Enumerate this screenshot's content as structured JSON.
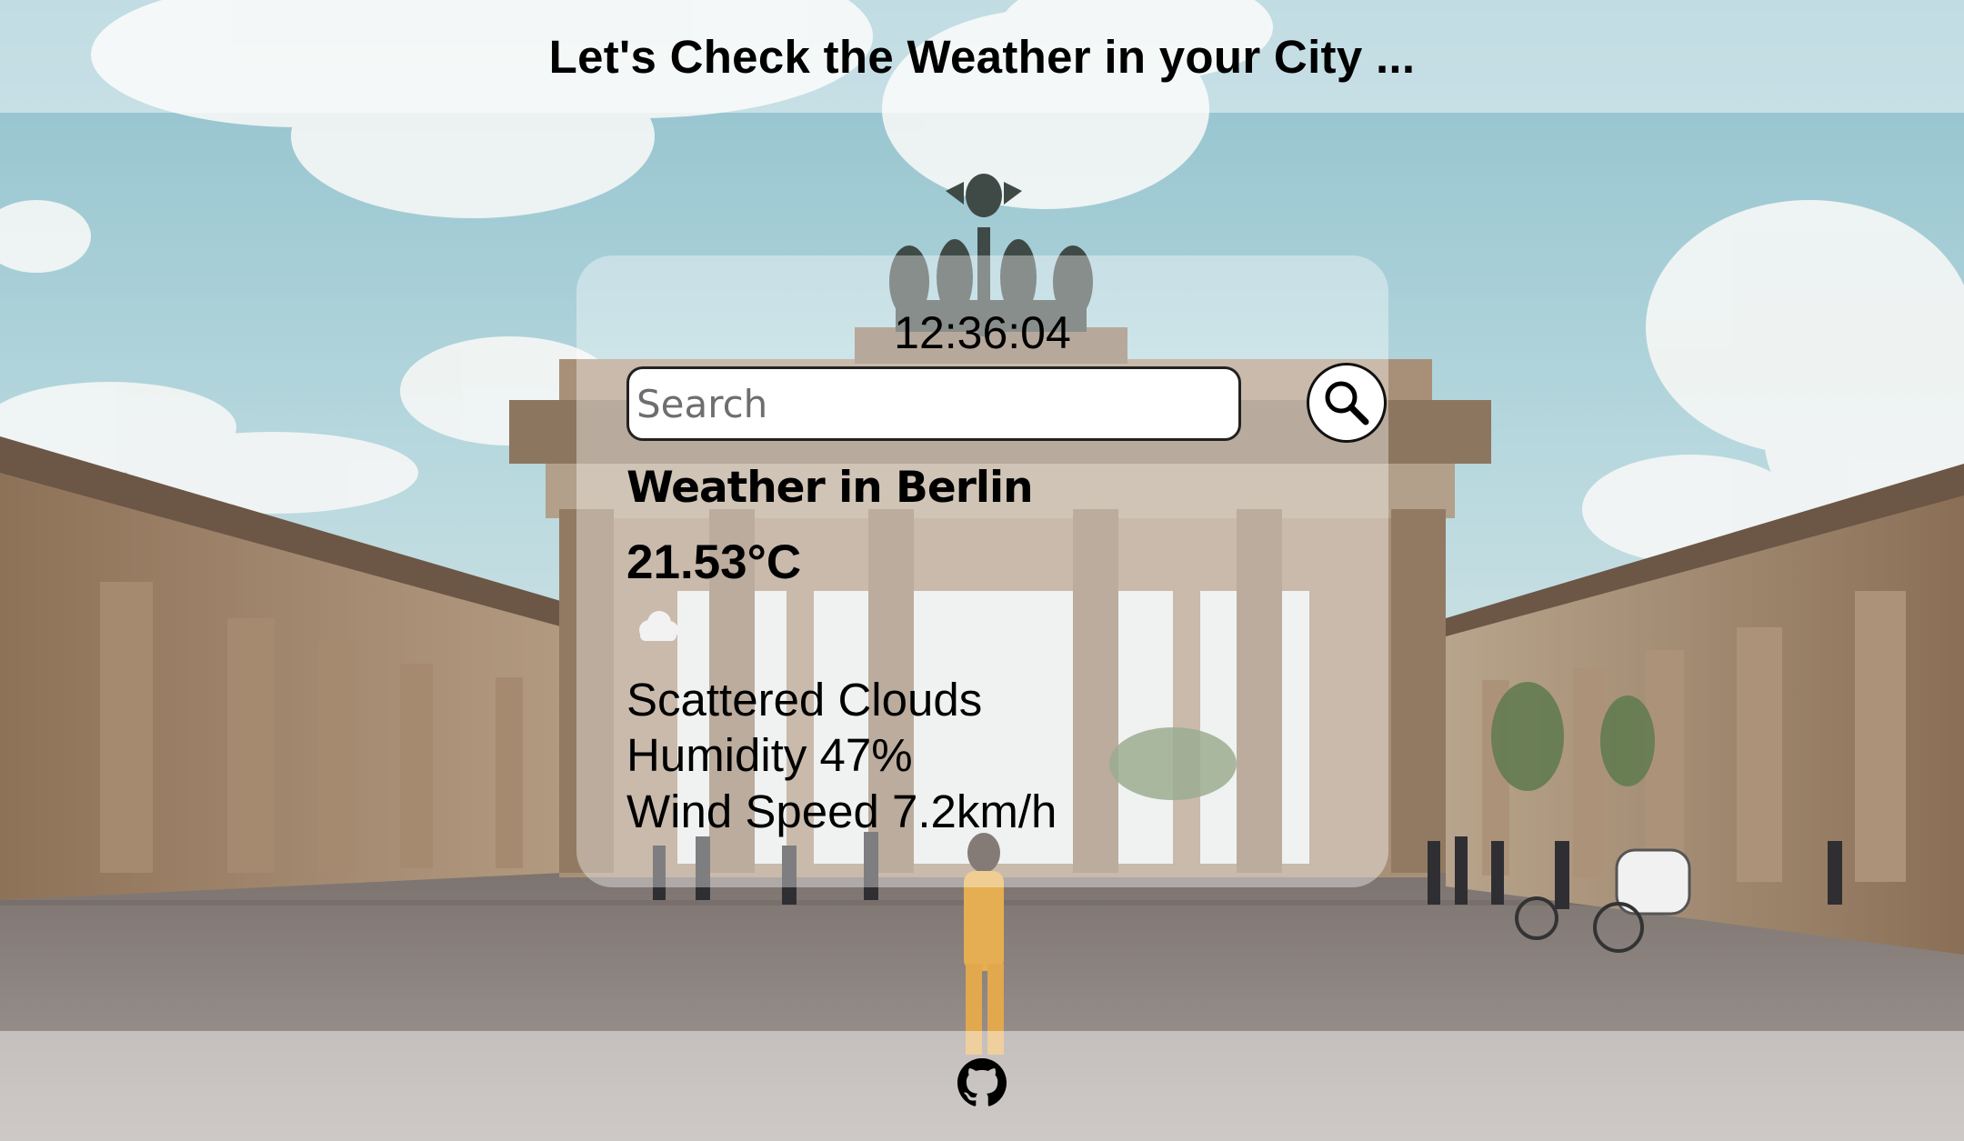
{
  "header": {
    "title": "Let's Check the Weather in your City ..."
  },
  "card": {
    "clock": "12:36:04",
    "search": {
      "placeholder": "Search",
      "value": "",
      "button_icon": "search-icon"
    },
    "city_heading": "Weather in Berlin",
    "temperature": "21.53°C",
    "condition_icon": "cloud-icon",
    "description": "Scattered Clouds",
    "humidity": "Humidity 47%",
    "wind_speed": "Wind Speed 7.2km/h"
  },
  "footer": {
    "link_icon": "github-icon"
  },
  "colors": {
    "text": "#000000",
    "overlay": "rgba(255,255,255,0.4)",
    "sky": "#a8cfd8",
    "stone": "#9b8570"
  }
}
